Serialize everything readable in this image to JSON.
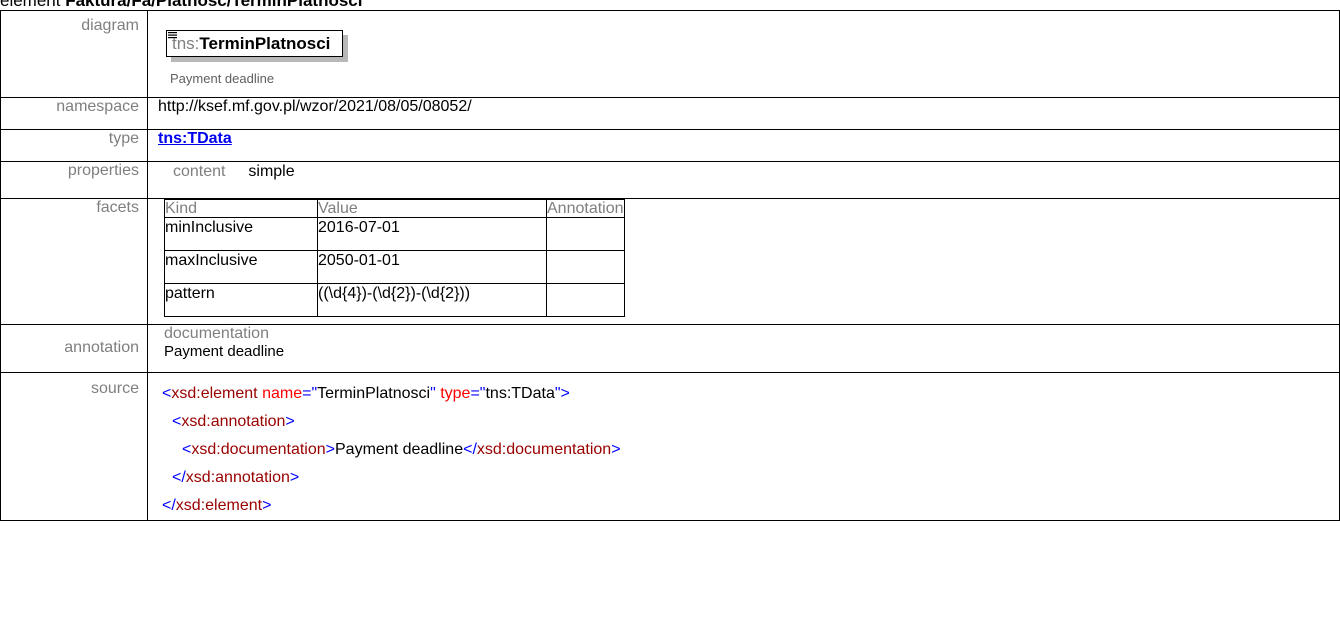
{
  "heading": {
    "prefix": "element ",
    "path": "Faktura/Fa/Platnosc/TerminPlatnosci"
  },
  "labels": {
    "diagram": "diagram",
    "namespace": "namespace",
    "type": "type",
    "properties": "properties",
    "facets": "facets",
    "annotation": "annotation",
    "source": "source"
  },
  "diagram": {
    "ns_prefix": "tns:",
    "element_name": "TerminPlatnosci",
    "documentation": "Payment deadline"
  },
  "namespace": "http://ksef.mf.gov.pl/wzor/2021/08/05/08052/",
  "type": "tns:TData",
  "properties": {
    "key": "content",
    "value": "simple"
  },
  "facets": {
    "headers": [
      "Kind",
      "Value",
      "Annotation"
    ],
    "rows": [
      {
        "kind": "minInclusive",
        "value": "2016-07-01",
        "annotation": ""
      },
      {
        "kind": "maxInclusive",
        "value": "2050-01-01",
        "annotation": ""
      },
      {
        "kind": "pattern",
        "value": "((\\d{4})-(\\d{2})-(\\d{2}))",
        "annotation": ""
      }
    ]
  },
  "annotation": {
    "label": "documentation",
    "text": "Payment deadline"
  },
  "source": {
    "line1": {
      "open": "<",
      "tag": "xsd:element",
      "attr1": "name",
      "eq1": "=\"",
      "val1": "TerminPlatnosci",
      "q1": "\"",
      "attr2": "type",
      "eq2": "=\"",
      "val2": "tns:TData",
      "close": "\">"
    },
    "line2": {
      "open": "<",
      "tag": "xsd:annotation",
      "close": ">"
    },
    "line3": {
      "open": "<",
      "tag": "xsd:documentation",
      "close": ">",
      "text": "Payment deadline",
      "endopen": "</",
      "endtag": "xsd:documentation",
      "endclose": ">"
    },
    "line4": {
      "open": "</",
      "tag": "xsd:annotation",
      "close": ">"
    },
    "line5": {
      "open": "</",
      "tag": "xsd:element",
      "close": ">"
    }
  }
}
